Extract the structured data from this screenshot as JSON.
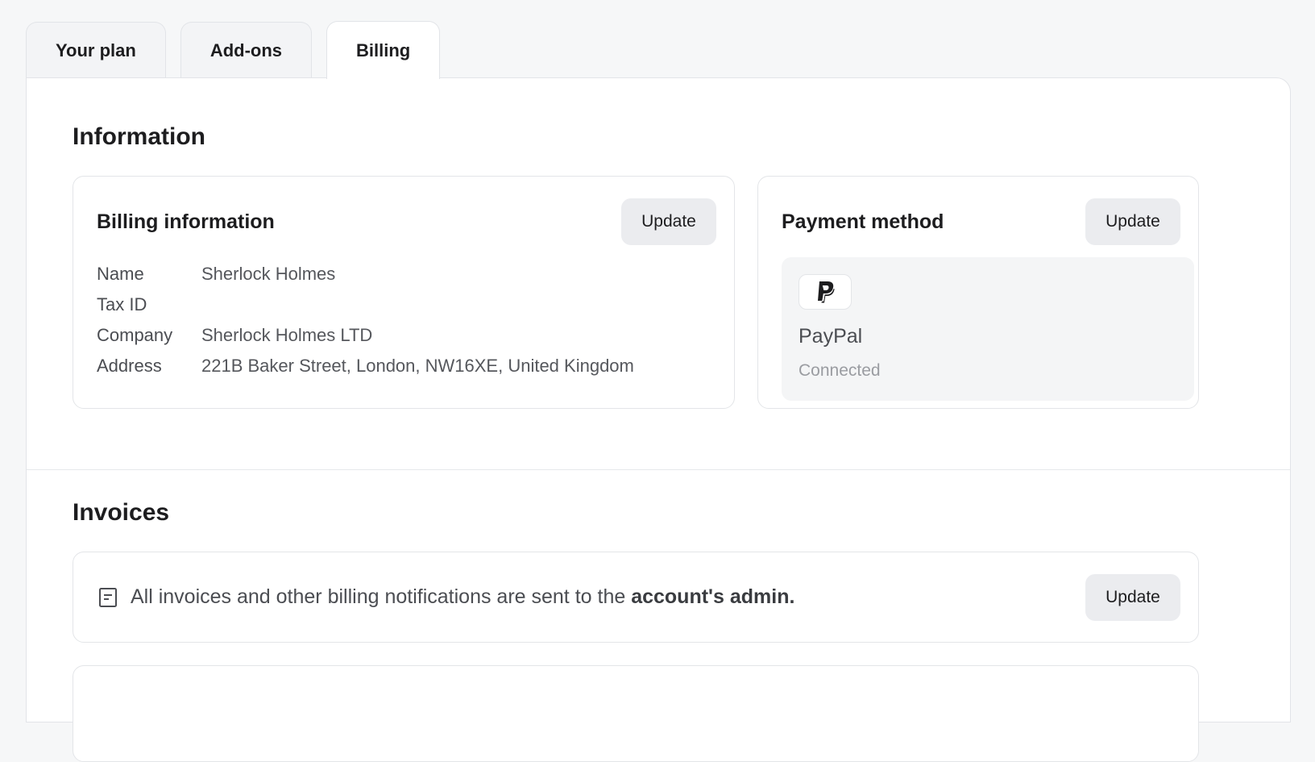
{
  "tabs": [
    {
      "label": "Your plan"
    },
    {
      "label": "Add-ons"
    },
    {
      "label": "Billing",
      "active": true
    }
  ],
  "information": {
    "title": "Information",
    "billing": {
      "title": "Billing information",
      "update_label": "Update",
      "rows": [
        {
          "label": "Name",
          "value": "Sherlock Holmes"
        },
        {
          "label": "Tax ID",
          "value": ""
        },
        {
          "label": "Company",
          "value": "Sherlock Holmes LTD"
        },
        {
          "label": "Address",
          "value": "221B Baker Street, London, NW16XE, United Kingdom"
        }
      ]
    },
    "payment": {
      "title": "Payment method",
      "update_label": "Update",
      "method_name": "PayPal",
      "method_status": "Connected",
      "logo_icon": "paypal-icon"
    }
  },
  "invoices": {
    "title": "Invoices",
    "notice_prefix": "All invoices and other billing notifications are sent to the",
    "notice_strong": "account's admin.",
    "update_label": "Update",
    "notice_icon": "document-icon"
  },
  "colors": {
    "page_bg": "#f6f7f8",
    "panel_bg": "#ffffff",
    "button_bg": "#ebecef",
    "muted_text": "#9a9ca1"
  }
}
